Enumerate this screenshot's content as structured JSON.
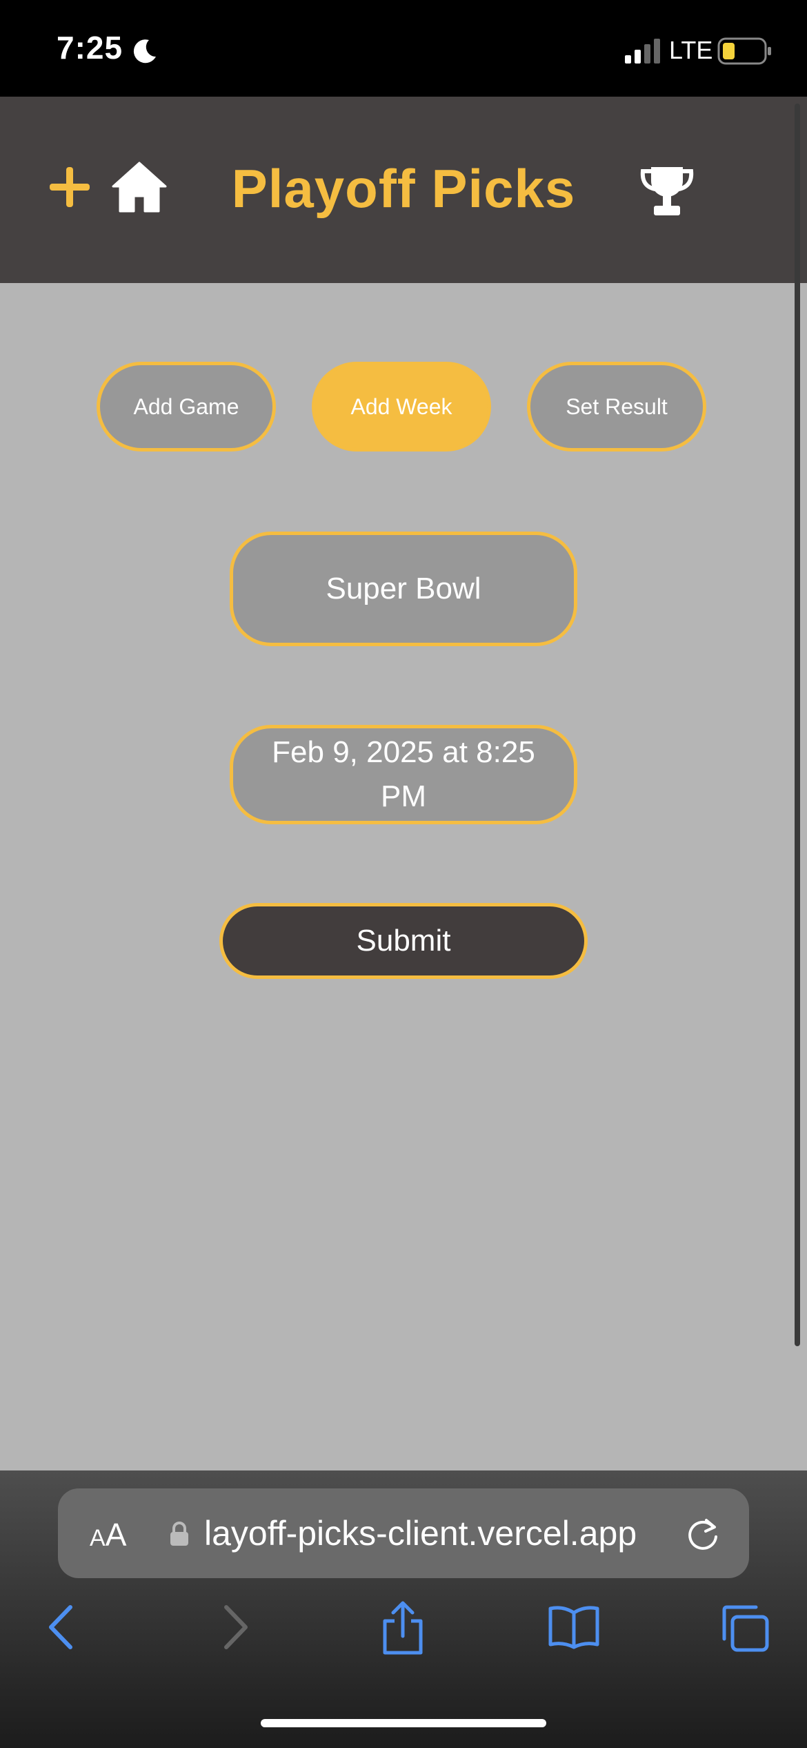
{
  "status_bar": {
    "time": "7:25",
    "network": "LTE",
    "battery_level": 0.3,
    "battery_color": "#f5d33b"
  },
  "header": {
    "title": "Playoff Picks",
    "icons": [
      "plus-icon",
      "home-icon",
      "trophy-icon"
    ],
    "accent_color": "#f5bd41",
    "background": "#454141"
  },
  "tabs": [
    {
      "label": "Add Game",
      "active": false
    },
    {
      "label": "Add Week",
      "active": true
    },
    {
      "label": "Set Result",
      "active": false
    }
  ],
  "form": {
    "week_name": "Super Bowl",
    "deadline": "Feb 9, 2025 at 8:25 PM",
    "submit_label": "Submit"
  },
  "browser": {
    "text_size_label_small": "A",
    "text_size_label_large": "A",
    "url": "layoff-picks-client.vercel.app",
    "toolbar_icons": [
      "back-icon",
      "forward-icon",
      "share-icon",
      "bookmarks-icon",
      "tabs-icon"
    ]
  }
}
